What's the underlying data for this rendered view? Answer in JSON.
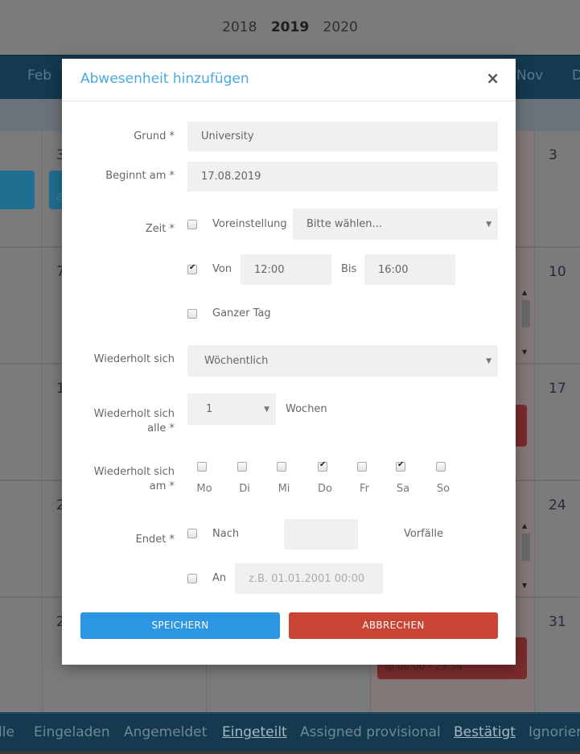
{
  "background": {
    "years": [
      {
        "label": "2018",
        "active": false
      },
      {
        "label": "2019",
        "active": true
      },
      {
        "label": "2020",
        "active": false
      }
    ],
    "months_visible": [
      "Feb",
      "Nov",
      "D"
    ],
    "day_numbers_left_partial": [
      "3",
      "7",
      "1",
      "2",
      "2"
    ],
    "day_numbers_right": [
      "3",
      "10",
      "17",
      "24",
      "31"
    ],
    "event_time_text": "@ 00:00 - 23:59",
    "event_left_partial_text": "@",
    "filters": [
      {
        "label": "lle",
        "active": false
      },
      {
        "label": "Eingeladen",
        "active": false
      },
      {
        "label": "Angemeldet",
        "active": false
      },
      {
        "label": "Eingeteilt",
        "active": true
      },
      {
        "label": "Assigned provisional",
        "active": false
      },
      {
        "label": "Bestätigt",
        "active": true
      },
      {
        "label": "Ignorier",
        "active": false
      }
    ]
  },
  "modal": {
    "title": "Abwesenheit hinzufügen",
    "close_icon": "×",
    "grund": {
      "label": "Grund *",
      "value": "University"
    },
    "beginnt": {
      "label": "Beginnt am *",
      "value": "17.08.2019"
    },
    "zeit": {
      "label": "Zeit *",
      "preset": {
        "label": "Voreinstellung",
        "checked": false,
        "select_value": "Bitte wählen..."
      },
      "range": {
        "checked": true,
        "from_label": "Von",
        "from_value": "12:00",
        "to_label": "Bis",
        "to_value": "16:00"
      },
      "all_day": {
        "label": "Ganzer Tag",
        "checked": false
      }
    },
    "repeat": {
      "label": "Wiederholt sich",
      "value": "Wöchentlich"
    },
    "repeat_every": {
      "label_line1": "Wiederholt sich",
      "label_line2": "alle *",
      "value": "1",
      "unit": "Wochen"
    },
    "repeat_on": {
      "label_line1": "Wiederholt sich",
      "label_line2": "am *",
      "days": [
        {
          "label": "Mo",
          "checked": false
        },
        {
          "label": "Di",
          "checked": false
        },
        {
          "label": "Mi",
          "checked": false
        },
        {
          "label": "Do",
          "checked": true
        },
        {
          "label": "Fr",
          "checked": false
        },
        {
          "label": "Sa",
          "checked": true
        },
        {
          "label": "So",
          "checked": false
        }
      ]
    },
    "ends": {
      "label": "Endet *",
      "after": {
        "label": "Nach",
        "checked": false,
        "value": "",
        "unit": "Vorfälle"
      },
      "on": {
        "label": "An",
        "checked": false,
        "value": "",
        "placeholder": "z.B. 01.01.2001 00:00"
      }
    },
    "save_label": "SPEICHERN",
    "cancel_label": "ABBRECHEN"
  },
  "colors": {
    "title": "#4aa8e0",
    "save": "#2d96e2",
    "cancel": "#c94435",
    "field_bg": "#eff0f1"
  }
}
